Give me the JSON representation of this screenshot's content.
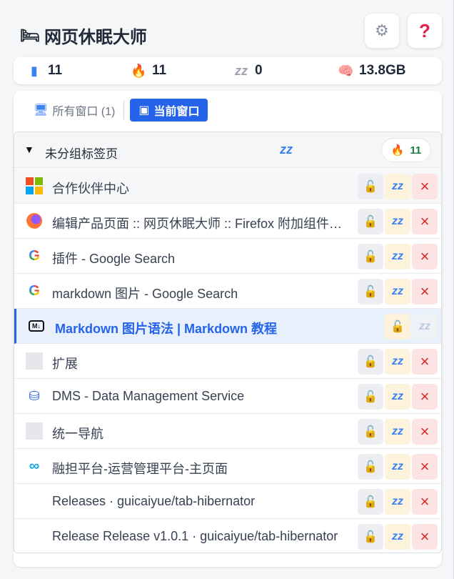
{
  "app": {
    "title": "网页休眠大师",
    "title_icon": "bed-icon"
  },
  "header_buttons": {
    "settings_icon": "gear-icon",
    "help_icon": "question-icon"
  },
  "stats": {
    "total_tabs": "11",
    "active_tabs": "11",
    "sleeping_tabs": "0",
    "memory": "13.8GB"
  },
  "tabs": [
    {
      "label": "所有窗口 (1)",
      "icon": "monitor-icon",
      "active": false
    },
    {
      "label": "当前窗口",
      "icon": "window-icon",
      "active": true
    }
  ],
  "group": {
    "title": "未分组标签页",
    "count": "11"
  },
  "rows": [
    {
      "title": "合作伙伴中心",
      "favicon": "microsoft-icon"
    },
    {
      "title": "编辑产品页面 :: 网页休眠大师 :: Firefox 附加组件工作坊",
      "favicon": "firefox-icon"
    },
    {
      "title": "插件 - Google Search",
      "favicon": "google-icon"
    },
    {
      "title": "markdown 图片 - Google Search",
      "favicon": "google-icon"
    },
    {
      "title": "Markdown 图片语法 | Markdown 教程",
      "favicon": "markdown-icon",
      "active": true
    },
    {
      "title": "扩展",
      "favicon": "blank-icon"
    },
    {
      "title": "DMS - Data Management Service",
      "favicon": "dms-icon"
    },
    {
      "title": "统一导航",
      "favicon": "blank-icon"
    },
    {
      "title": "融担平台-运营管理平台-主页面",
      "favicon": "infinity-icon"
    },
    {
      "title": "Releases · guicaiyue/tab-hibernator",
      "favicon": "none"
    },
    {
      "title": "Release Release v1.0.1 · guicaiyue/tab-hibernator",
      "favicon": "none"
    }
  ],
  "colors": {
    "accent": "#2563eb",
    "close": "#dc2626",
    "lock_bg": "#fdf2dc",
    "active_row_bg": "#e8f1fb"
  }
}
